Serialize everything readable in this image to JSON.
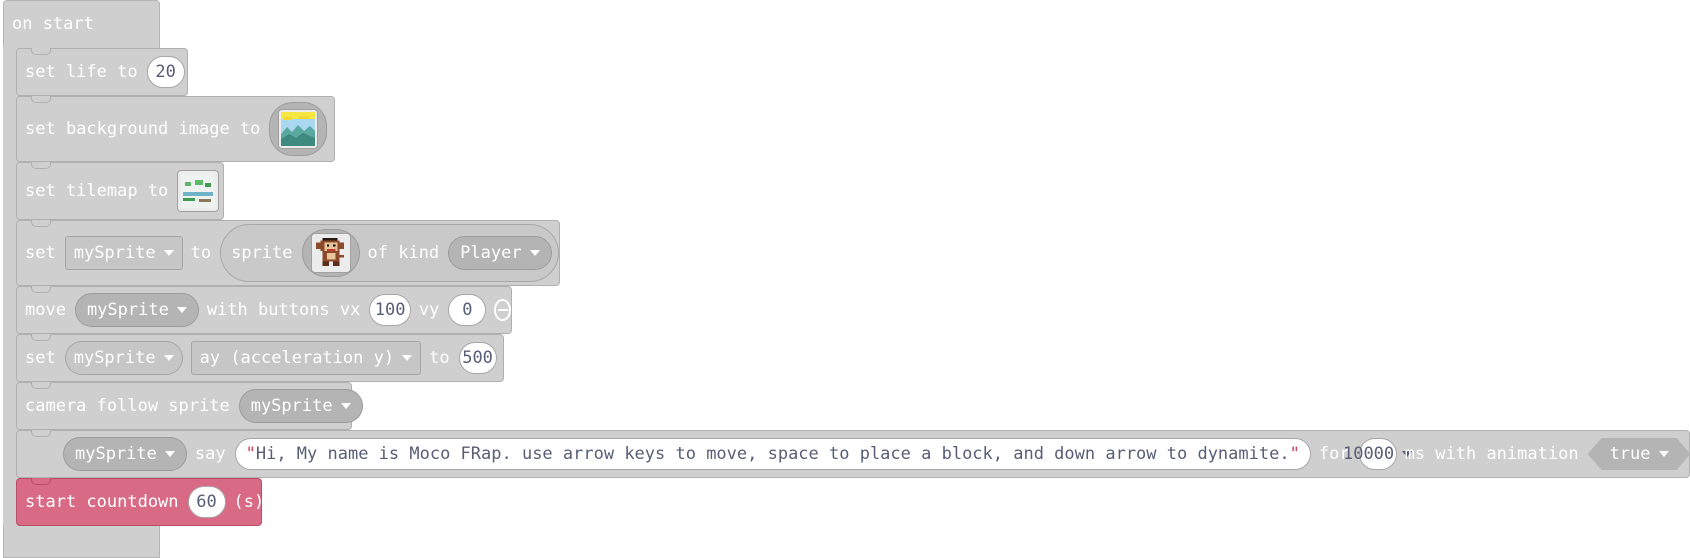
{
  "on_start": {
    "label": "on start"
  },
  "set_life": {
    "prefix": "set life to",
    "value": "20"
  },
  "set_background": {
    "prefix": "set background image to"
  },
  "set_tilemap": {
    "prefix": "set tilemap to"
  },
  "set_sprite": {
    "set": "set",
    "variable": "mySprite",
    "to": "to",
    "sprite_label": "sprite",
    "of_kind": "of kind",
    "kind": "Player"
  },
  "move_sprite": {
    "move": "move",
    "variable": "mySprite",
    "with_buttons": "with buttons vx",
    "vx": "100",
    "vy_label": "vy",
    "vy": "0"
  },
  "set_accel": {
    "set": "set",
    "variable": "mySprite",
    "property": "ay (acceleration y)",
    "to": "to",
    "value": "500"
  },
  "camera_follow": {
    "label": "camera follow sprite",
    "variable": "mySprite"
  },
  "say": {
    "variable": "mySprite",
    "say": "say",
    "text": "Hi, My name is Moco FRap. use arrow keys to move, space to place a block, and down arrow to dynamite.",
    "for": "for",
    "duration": "10000",
    "ms_with_animation": "ms with animation",
    "animation": "true"
  },
  "countdown": {
    "label": "start countdown",
    "value": "60",
    "unit": "(s)"
  },
  "colors": {
    "block_gray": "#cfcfcf",
    "countdown_pink": "#d86a86",
    "text_slate": "#575e75"
  }
}
